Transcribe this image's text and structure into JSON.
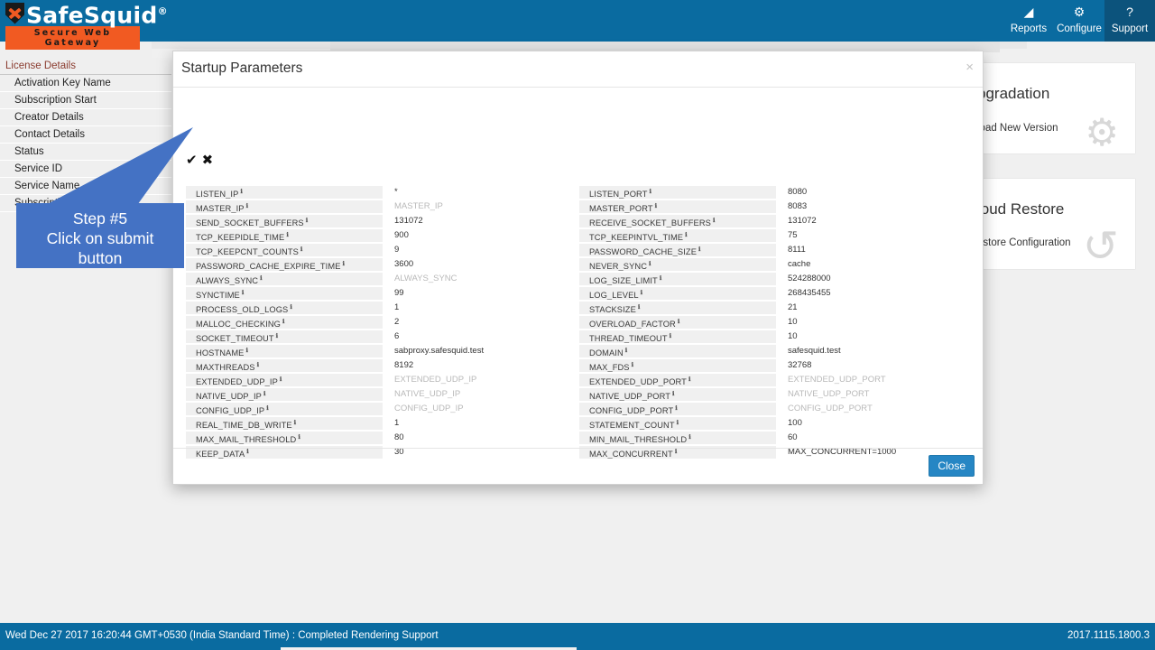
{
  "brand": {
    "name": "SafeSquid",
    "registered": "®",
    "tagline": "Secure Web Gateway",
    "logo_icon": "shield-x-icon",
    "accent_color": "#f15a22",
    "header_color": "#0a6ba0"
  },
  "nav": {
    "items": [
      {
        "label": "Reports",
        "icon": "chart-icon",
        "glyph": "◢",
        "active": false
      },
      {
        "label": "Configure",
        "icon": "gears-icon",
        "glyph": "⚙",
        "active": false
      },
      {
        "label": "Support",
        "icon": "help-circle-icon",
        "glyph": "?",
        "active": true
      }
    ]
  },
  "sidebar": {
    "heading": "License Details",
    "items": [
      {
        "label": "Activation Key Name"
      },
      {
        "label": "Subscription Start"
      },
      {
        "label": "Creator Details"
      },
      {
        "label": "Contact Details"
      },
      {
        "label": "Status"
      },
      {
        "label": "Service ID"
      },
      {
        "label": "Service Name"
      },
      {
        "label": "Subscription Type"
      }
    ]
  },
  "background_cards": [
    {
      "title": "pgradation",
      "subtitle": "load New Version",
      "icon": "gear-icon",
      "glyph": "⚙"
    },
    {
      "title": "loud Restore",
      "subtitle": "estore Configuration",
      "icon": "restore-arrow-icon",
      "glyph": "↺"
    }
  ],
  "modal": {
    "title": "Startup Parameters",
    "close_icon": "close-icon",
    "close_glyph": "×",
    "actions": [
      {
        "name": "submit",
        "icon": "check-icon",
        "glyph": "✔"
      },
      {
        "name": "cancel",
        "icon": "cross-icon",
        "glyph": "✖"
      }
    ],
    "footer": {
      "close_label": "Close"
    },
    "info_glyph": "ℹ",
    "columns": [
      {
        "name": "left",
        "rows": [
          {
            "label": "LISTEN_IP",
            "value": "*",
            "placeholder": false
          },
          {
            "label": "MASTER_IP",
            "value": "MASTER_IP",
            "placeholder": true
          },
          {
            "label": "SEND_SOCKET_BUFFERS",
            "value": "131072",
            "placeholder": false
          },
          {
            "label": "TCP_KEEPIDLE_TIME",
            "value": "900",
            "placeholder": false
          },
          {
            "label": "TCP_KEEPCNT_COUNTS",
            "value": "9",
            "placeholder": false
          },
          {
            "label": "PASSWORD_CACHE_EXPIRE_TIME",
            "value": "3600",
            "placeholder": false
          },
          {
            "label": "ALWAYS_SYNC",
            "value": "ALWAYS_SYNC",
            "placeholder": true
          },
          {
            "label": "SYNCTIME",
            "value": "99",
            "placeholder": false
          },
          {
            "label": "PROCESS_OLD_LOGS",
            "value": "1",
            "placeholder": false
          },
          {
            "label": "MALLOC_CHECKING",
            "value": "2",
            "placeholder": false
          },
          {
            "label": "SOCKET_TIMEOUT",
            "value": "6",
            "placeholder": false
          },
          {
            "label": "HOSTNAME",
            "value": "sabproxy.safesquid.test",
            "placeholder": false
          },
          {
            "label": "MAXTHREADS",
            "value": "8192",
            "placeholder": false
          },
          {
            "label": "EXTENDED_UDP_IP",
            "value": "EXTENDED_UDP_IP",
            "placeholder": true
          },
          {
            "label": "NATIVE_UDP_IP",
            "value": "NATIVE_UDP_IP",
            "placeholder": true
          },
          {
            "label": "CONFIG_UDP_IP",
            "value": "CONFIG_UDP_IP",
            "placeholder": true
          },
          {
            "label": "REAL_TIME_DB_WRITE",
            "value": "1",
            "placeholder": false
          },
          {
            "label": "MAX_MAIL_THRESHOLD",
            "value": "80",
            "placeholder": false
          },
          {
            "label": "KEEP_DATA",
            "value": "30",
            "placeholder": false
          }
        ]
      },
      {
        "name": "right",
        "rows": [
          {
            "label": "LISTEN_PORT",
            "value": "8080",
            "placeholder": false
          },
          {
            "label": "MASTER_PORT",
            "value": "8083",
            "placeholder": false
          },
          {
            "label": "RECEIVE_SOCKET_BUFFERS",
            "value": "131072",
            "placeholder": false
          },
          {
            "label": "TCP_KEEPINTVL_TIME",
            "value": "75",
            "placeholder": false
          },
          {
            "label": "PASSWORD_CACHE_SIZE",
            "value": "8111",
            "placeholder": false
          },
          {
            "label": "NEVER_SYNC",
            "value": "cache",
            "placeholder": false
          },
          {
            "label": "LOG_SIZE_LIMIT",
            "value": "524288000",
            "placeholder": false
          },
          {
            "label": "LOG_LEVEL",
            "value": "268435455",
            "placeholder": false
          },
          {
            "label": "STACKSIZE",
            "value": "21",
            "placeholder": false
          },
          {
            "label": "OVERLOAD_FACTOR",
            "value": "10",
            "placeholder": false
          },
          {
            "label": "THREAD_TIMEOUT",
            "value": "10",
            "placeholder": false
          },
          {
            "label": "DOMAIN",
            "value": "safesquid.test",
            "placeholder": false
          },
          {
            "label": "MAX_FDS",
            "value": "32768",
            "placeholder": false
          },
          {
            "label": "EXTENDED_UDP_PORT",
            "value": "EXTENDED_UDP_PORT",
            "placeholder": true
          },
          {
            "label": "NATIVE_UDP_PORT",
            "value": "NATIVE_UDP_PORT",
            "placeholder": true
          },
          {
            "label": "CONFIG_UDP_PORT",
            "value": "CONFIG_UDP_PORT",
            "placeholder": true
          },
          {
            "label": "STATEMENT_COUNT",
            "value": "100",
            "placeholder": false
          },
          {
            "label": "MIN_MAIL_THRESHOLD",
            "value": "60",
            "placeholder": false
          },
          {
            "label": "MAX_CONCURRENT",
            "value": "MAX_CONCURRENT=1000",
            "placeholder": false
          }
        ]
      }
    ]
  },
  "callout": {
    "step": "Step #5",
    "line2": "Click on submit",
    "line3": "button",
    "color": "#4472c4"
  },
  "footer": {
    "status": "Wed Dec 27 2017 16:20:44 GMT+0530 (India Standard Time) : Completed Rendering Support",
    "version": "2017.1115.1800.3"
  }
}
